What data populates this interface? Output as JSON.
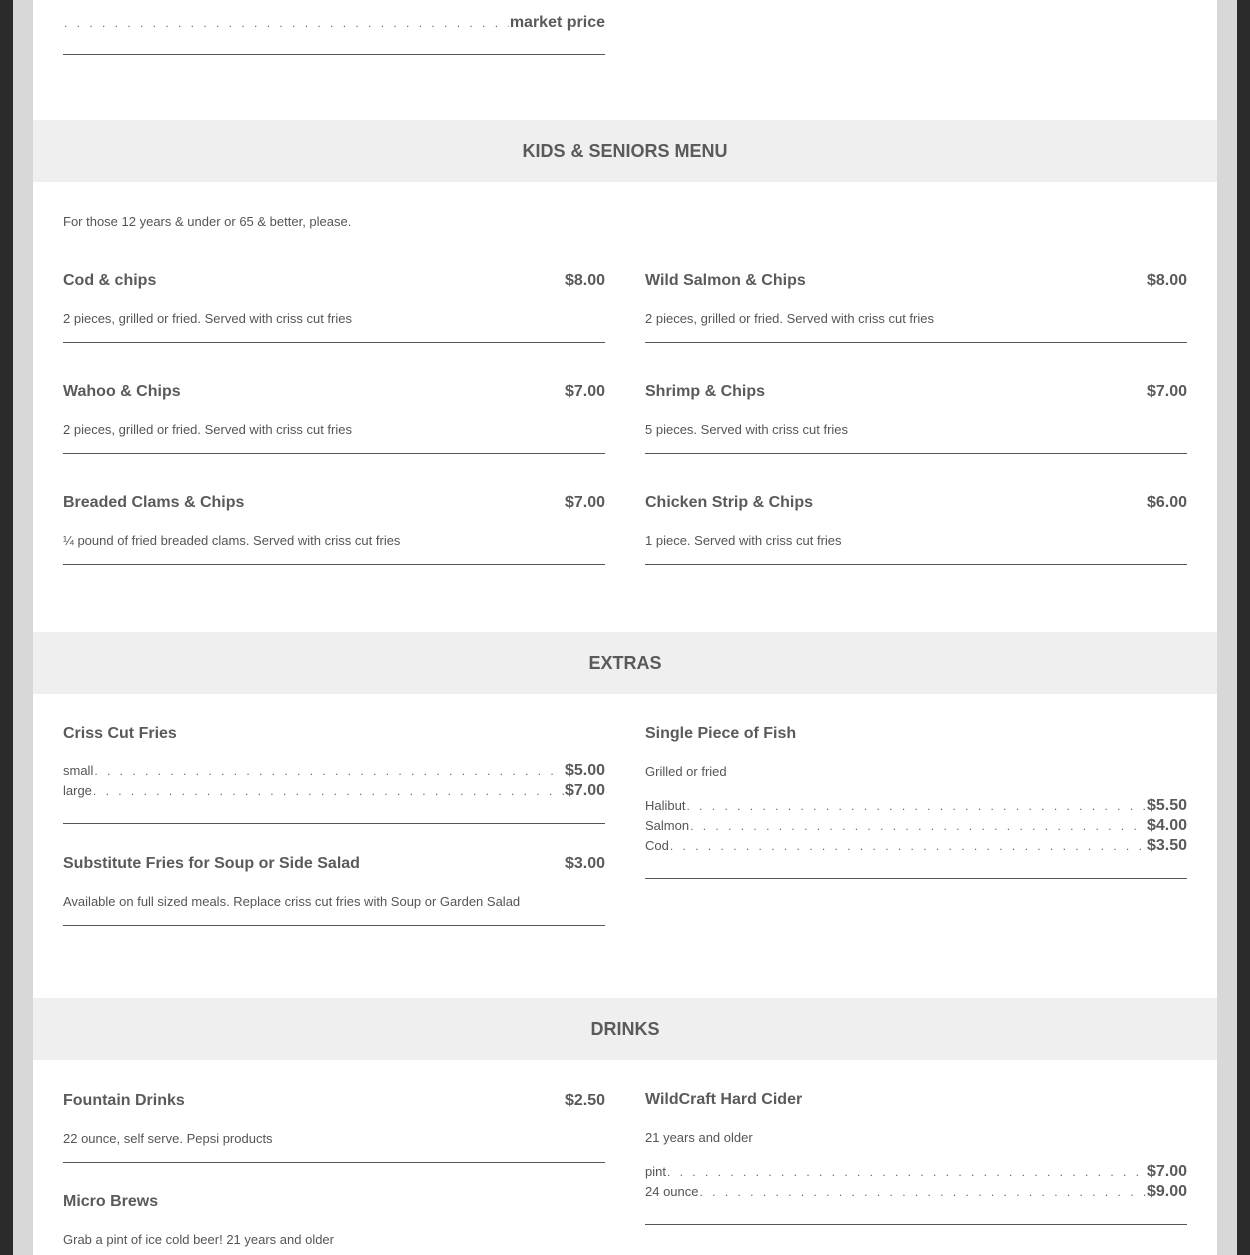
{
  "top": {
    "price": "market price"
  },
  "kids": {
    "title": "KIDS & SENIORS MENU",
    "intro": "For those 12 years & under or 65 & better, please.",
    "items": [
      {
        "name": "Cod & chips",
        "price": "$8.00",
        "desc": "2 pieces, grilled or fried. Served with criss cut fries"
      },
      {
        "name": "Wild Salmon & Chips",
        "price": "$8.00",
        "desc": "2 pieces, grilled or fried. Served with criss cut fries"
      },
      {
        "name": "Wahoo & Chips",
        "price": "$7.00",
        "desc": "2 pieces, grilled or fried. Served with criss cut fries"
      },
      {
        "name": "Shrimp & Chips",
        "price": "$7.00",
        "desc": "5 pieces. Served with criss cut fries"
      },
      {
        "name": "Breaded Clams & Chips",
        "price": "$7.00",
        "desc": "¼ pound of fried breaded clams. Served with criss cut fries"
      },
      {
        "name": "Chicken Strip & Chips",
        "price": "$6.00",
        "desc": "1 piece. Served with criss cut fries"
      }
    ]
  },
  "extras": {
    "title": "EXTRAS",
    "fries": {
      "name": "Criss Cut Fries",
      "options": [
        {
          "label": "small",
          "price": "$5.00"
        },
        {
          "label": "large",
          "price": "$7.00"
        }
      ]
    },
    "substitute": {
      "name": "Substitute Fries for Soup or Side Salad",
      "price": "$3.00",
      "desc": "Available on full sized meals. Replace criss cut fries with Soup or Garden Salad"
    },
    "fish": {
      "name": "Single Piece of Fish",
      "desc": "Grilled or fried",
      "options": [
        {
          "label": "Halibut",
          "price": "$5.50"
        },
        {
          "label": "Salmon",
          "price": "$4.00"
        },
        {
          "label": "Cod",
          "price": "$3.50"
        }
      ]
    }
  },
  "drinks": {
    "title": "DRINKS",
    "fountain": {
      "name": "Fountain Drinks",
      "price": "$2.50",
      "desc": "22 ounce, self serve. Pepsi products"
    },
    "brews": {
      "name": "Micro Brews",
      "desc": "Grab a pint of ice cold beer! 21 years and older"
    },
    "cider": {
      "name": "WildCraft Hard Cider",
      "desc": "21 years and older",
      "options": [
        {
          "label": "pint",
          "price": "$7.00"
        },
        {
          "label": "24 ounce",
          "price": "$9.00"
        }
      ]
    }
  }
}
